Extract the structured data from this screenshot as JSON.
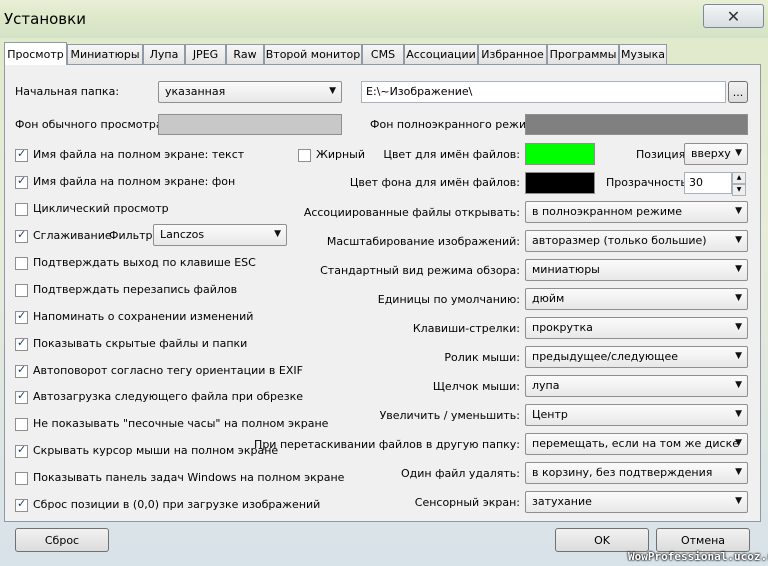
{
  "window": {
    "title": "Установки",
    "close_glyph": "✕"
  },
  "tabs": [
    "Просмотр",
    "Миниатюры",
    "Лупа",
    "JPEG",
    "Raw",
    "Второй монитор",
    "CMS",
    "Ассоциации",
    "Избранное",
    "Программы",
    "Музыка"
  ],
  "left": {
    "start_folder_label": "Начальная папка:",
    "start_folder_value": "указанная",
    "bg_normal_label": "Фон обычного просмотра:",
    "fullscreen_text": "Имя файла на полном экране: текст",
    "bold": "Жирный",
    "fullscreen_bg": "Имя файла на полном экране: фон",
    "cyclic": "Циклический просмотр",
    "smoothing": "Сглаживание",
    "filter_label": "Фильтр:",
    "filter_value": "Lanczos",
    "confirm_esc": "Подтверждать выход по клавише ESC",
    "confirm_overwrite": "Подтверждать перезапись файлов",
    "remind_save": "Напоминать о сохранении изменений",
    "show_hidden": "Показывать скрытые файлы и папки",
    "autorotate": "Автоповорот согласно тегу ориентации в EXIF",
    "autoload": "Автозагрузка следующего файла при обрезке",
    "no_hourglass": "Не показывать \"песочные часы\" на полном экране",
    "hide_cursor": "Скрывать курсор мыши на полном экране",
    "show_taskbar": "Показывать панель задач Windows на полном экране",
    "reset_pos": "Сброс позиции в (0,0) при загрузке изображений"
  },
  "right": {
    "path_value": "E:\\~Изображение\\",
    "browse": "...",
    "bg_fullscreen_label": "Фон полноэкранного режима:",
    "name_color_label": "Цвет для имён файлов:",
    "position_label": "Позиция:",
    "position_value": "вверху",
    "name_bg_label": "Цвет фона для имён файлов:",
    "transparency_label": "Прозрачность:",
    "transparency_value": "30",
    "rows": [
      {
        "label": "Ассоциированные файлы открывать:",
        "value": "в полноэкранном режиме"
      },
      {
        "label": "Масштабирование изображений:",
        "value": "авторазмер (только большие)"
      },
      {
        "label": "Стандартный вид режима обзора:",
        "value": "миниатюры"
      },
      {
        "label": "Единицы по умолчанию:",
        "value": "дюйм"
      },
      {
        "label": "Клавиши-стрелки:",
        "value": "прокрутка"
      },
      {
        "label": "Ролик мыши:",
        "value": "предыдущее/следующее"
      },
      {
        "label": "Щелчок мыши:",
        "value": "лупа"
      },
      {
        "label": "Увеличить / уменьшить:",
        "value": "Центр"
      },
      {
        "label": "При перетаскивании файлов в другую папку:",
        "value": "перемещать, если на том же диске"
      },
      {
        "label": "Один файл удалять:",
        "value": "в корзину, без подтверждения"
      },
      {
        "label": "Сенсорный экран:",
        "value": "затухание"
      }
    ]
  },
  "buttons": {
    "reset": "Сброс",
    "ok": "OK",
    "cancel": "Отмена"
  },
  "colors": {
    "bg_normal": "#c8c8c8",
    "bg_fullscreen": "#808080",
    "name_color": "#00ff00",
    "name_bg": "#000000"
  },
  "watermark": "WowProfessional.ucoz.ru"
}
